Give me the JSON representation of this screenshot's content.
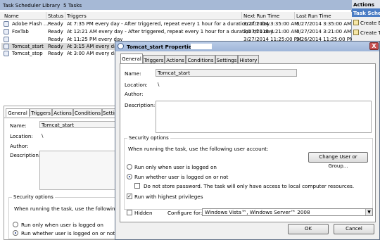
{
  "library": {
    "title": "Task Scheduler Library",
    "count": "5 Tasks"
  },
  "columns": [
    "Name",
    "Status",
    "Triggers",
    "Next Run Time",
    "Last Run Time"
  ],
  "tasks": [
    {
      "name": "Adobe Flash ...",
      "status": "Ready",
      "triggers": "At 7:35 PM every day - After triggered, repeat every 1 hour for a duration of 1 day.",
      "next": "3/27/2014 3:35:00 AM",
      "last": "3/27/2014 3:35:00 AM"
    },
    {
      "name": "FoxTab",
      "status": "Ready",
      "triggers": "At 12:21 AM every day - After triggered, repeat every 1 hour for a duration of 1 day.",
      "next": "3/27/2014 4:21:00 AM",
      "last": "3/27/2014 3:21:00 AM"
    },
    {
      "name": "",
      "status": "Ready",
      "triggers": "At 11:25 PM every day",
      "next": "3/27/2014 11:25:00 PM",
      "last": "3/26/2014 11:25:00 PM"
    },
    {
      "name": "Tomcat_start",
      "status": "Ready",
      "triggers": "At 3:15 AM every day",
      "next": "",
      "last": ""
    },
    {
      "name": "Tomcat_stop",
      "status": "Ready",
      "triggers": "At 3:00 AM every day",
      "next": "",
      "last": ""
    }
  ],
  "actions": {
    "title": "Actions",
    "section": "Task Scheduler",
    "items": [
      "Create B",
      "Create T"
    ]
  },
  "bottom": {
    "tabs": [
      "General",
      "Triggers",
      "Actions",
      "Conditions",
      "Settin"
    ],
    "name_label": "Name:",
    "name_value": "Tomcat_start",
    "location_label": "Location:",
    "location_value": "\\",
    "author_label": "Author:",
    "description_label": "Description:",
    "security_legend": "Security options",
    "account_text": "When running the task, use the following user",
    "radio_logged_on": "Run only when user is logged on",
    "radio_whether": "Run whether user is logged on or not"
  },
  "dialog": {
    "title": "Tomcat_start Properties",
    "close": "X",
    "tabs": [
      "General",
      "Triggers",
      "Actions",
      "Conditions",
      "Settings",
      "History"
    ],
    "name_label": "Name:",
    "name_value": "Tomcat_start",
    "location_label": "Location:",
    "location_value": "\\",
    "author_label": "Author:",
    "description_label": "Description:",
    "security_legend": "Security options",
    "account_text": "When running the task, use the following user account:",
    "change_user_button": "Change User or Group...",
    "radio_logged_on": "Run only when user is logged on",
    "radio_whether": "Run whether user is logged on or not",
    "no_store_password": "Do not store password.  The task will only have access to local computer resources.",
    "highest_privileges": "Run with highest privileges",
    "hidden_label": "Hidden",
    "configure_label": "Configure for:",
    "configure_value": "Windows Vista™, Windows Server™ 2008",
    "ok_button": "OK",
    "cancel_button": "Cancel"
  }
}
